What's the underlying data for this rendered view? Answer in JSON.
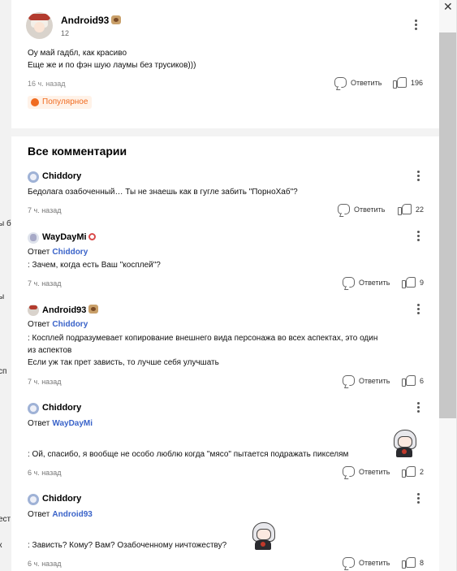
{
  "background": {
    "left_fragments": [
      "ы б",
      "ы",
      "сп",
      "ест",
      "к"
    ],
    "close_glyph": "✕"
  },
  "top_comment": {
    "author": "Android93",
    "sub": "12",
    "text_line1": "Оу май гадбл, как красиво",
    "text_line2": "Еще же и по фэн шую лаумы без трусиков)))",
    "time": "16 ч. назад",
    "reply_label": "Ответить",
    "likes": "196",
    "popular_label": "Популярное"
  },
  "section": {
    "title": "Все комментарии"
  },
  "comments": [
    {
      "author": "Chiddory",
      "text": "Бедолага озабоченный… Ты не знаешь как в гугле забить \"ПорноХаб\"?",
      "time": "7 ч. назад",
      "reply_label": "Ответить",
      "likes": "22"
    },
    {
      "author": "WayDayMi",
      "reply_prefix": "Ответ",
      "reply_to": "Chiddory",
      "text": ": Зачем, когда есть Ваш \"косплей\"?",
      "time": "7 ч. назад",
      "reply_label": "Ответить",
      "likes": "9"
    },
    {
      "author": "Android93",
      "reply_prefix": "Ответ",
      "reply_to": "Chiddory",
      "text_line1": ": Косплей подразумевает копирование внешнего вида персонажа во всех аспектах, это один",
      "text_line2": "из аспектов",
      "text_line3": "Если уж так прет зависть, то лучше себя улучшать",
      "time": "7 ч. назад",
      "reply_label": "Ответить",
      "likes": "6"
    },
    {
      "author": "Chiddory",
      "reply_prefix": "Ответ",
      "reply_to": "WayDayMi",
      "text": ": Ой, спасибо, я вообще не особо люблю когда \"мясо\" пытается подражать пикселям",
      "time": "6 ч. назад",
      "reply_label": "Ответить",
      "likes": "2"
    },
    {
      "author": "Chiddory",
      "reply_prefix": "Ответ",
      "reply_to": "Android93",
      "text": ": Зависть? Кому? Вам? Озабоченному ничтожеству?",
      "time": "6 ч. назад",
      "reply_label": "Ответить",
      "likes": "8"
    }
  ]
}
